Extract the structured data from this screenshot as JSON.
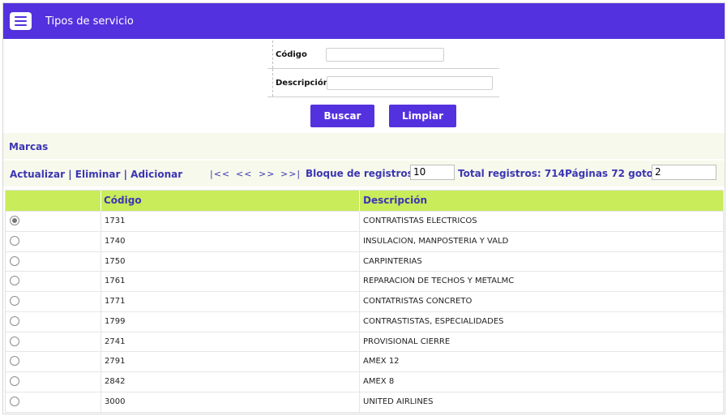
{
  "header": {
    "title": "Tipos de servicio",
    "icon": "list-window-icon"
  },
  "filter": {
    "codigo_label": "Código",
    "codigo_value": "",
    "descripcion_label": "Descripción",
    "descripcion_value": ""
  },
  "buttons": {
    "search_label": "Buscar",
    "clear_label": "Limpiar"
  },
  "section": {
    "title": "Marcas"
  },
  "toolbar": {
    "actualizar": "Actualizar",
    "eliminar": "Eliminar",
    "adicionar": "Adicionar",
    "separator": "|",
    "first": "|<<",
    "prev": "<<",
    "next": ">>",
    "last": ">>|",
    "block_label": "Bloque de registros:",
    "block_value": "10",
    "total_label": "Total registros: 714",
    "pages_label": "Páginas 72 goto:",
    "goto_value": "2"
  },
  "table": {
    "headers": [
      "",
      "Código",
      "Descripción"
    ],
    "selected_index": 0,
    "rows": [
      {
        "codigo": "1731",
        "descripcion": "CONTRATISTAS ELECTRICOS"
      },
      {
        "codigo": "1740",
        "descripcion": "INSULACION, MANPOSTERIA Y VALD"
      },
      {
        "codigo": "1750",
        "descripcion": "CARPINTERIAS"
      },
      {
        "codigo": "1761",
        "descripcion": "REPARACION DE TECHOS Y METALMC"
      },
      {
        "codigo": "1771",
        "descripcion": "CONTATRISTAS CONCRETO"
      },
      {
        "codigo": "1799",
        "descripcion": "CONTRASTISTAS, ESPECIALIDADES"
      },
      {
        "codigo": "2741",
        "descripcion": "PROVISIONAL CIERRE"
      },
      {
        "codigo": "2791",
        "descripcion": "AMEX 12"
      },
      {
        "codigo": "2842",
        "descripcion": "AMEX 8"
      },
      {
        "codigo": "3000",
        "descripcion": "UNITED AIRLINES"
      }
    ]
  },
  "colors": {
    "primary": "#5331de",
    "link": "#3c36b3",
    "table_header": "#c8ec5a",
    "panel_bg": "#f7f9ec"
  }
}
